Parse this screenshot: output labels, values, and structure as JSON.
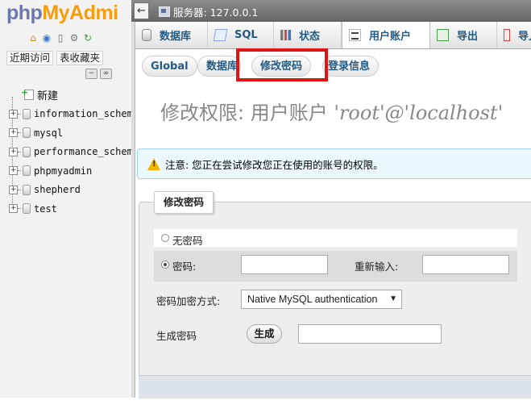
{
  "nav": {
    "logo_part1": "php",
    "logo_part2": "MyAdmi",
    "links": [
      "近期访问",
      "表收藏夹"
    ],
    "new_label": "新建",
    "databases": [
      "information_schema",
      "mysql",
      "performance_schema",
      "phpmyadmin",
      "shepherd",
      "test"
    ]
  },
  "topbar": {
    "collapse_glyph": "←",
    "server_text": "服务器: 127.0.0.1"
  },
  "menu": {
    "tabs": [
      "数据库",
      "SQL",
      "状态",
      "用户账户",
      "导出",
      "导入"
    ],
    "active": "用户账户"
  },
  "subtabs": [
    "Global",
    "数据库",
    "修改密码",
    "登录信息"
  ],
  "heading": {
    "prefix": "修改权限:  用户账户 ",
    "account": "'root'@'localhost'"
  },
  "notice": {
    "text": "注意: 您正在尝试修改您正在使用的账号的权限。"
  },
  "form": {
    "legend": "修改密码",
    "no_password_label": "无密码",
    "password_label": "密码:",
    "reenter_label": "重新输入:",
    "hashing_label": "密码加密方式:",
    "hashing_value": "Native MySQL authentication",
    "generate_label": "生成密码",
    "generate_button": "生成"
  },
  "colors": {
    "highlight": "#e01414",
    "link_blue": "#235a81",
    "notice_bg": "#ebf8fd",
    "logo_blue": "#6c78af",
    "logo_orange": "#f89c0e"
  }
}
